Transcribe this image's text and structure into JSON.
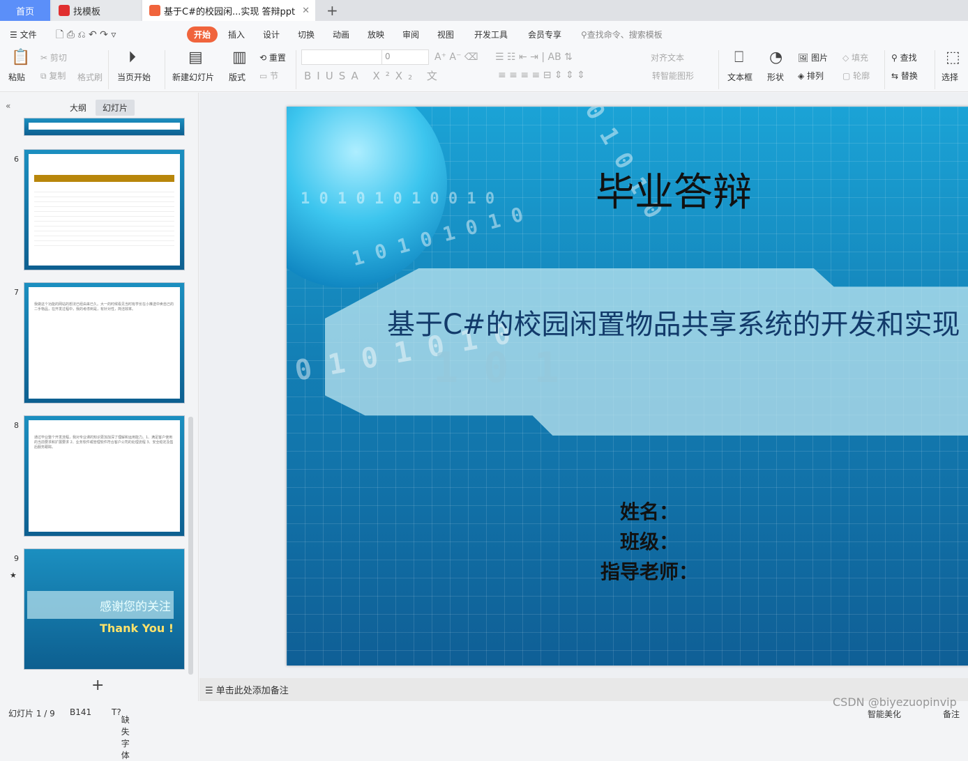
{
  "tabs": {
    "home": "首页",
    "templates": "找模板",
    "document": "基于C#的校园闲...实现 答辩ppt",
    "add": "+"
  },
  "menu": {
    "file": "文件",
    "items": [
      "开始",
      "插入",
      "设计",
      "切换",
      "动画",
      "放映",
      "审阅",
      "视图",
      "开发工具",
      "会员专享"
    ],
    "search_placeholder": "查找命令、搜索模板"
  },
  "ribbon": {
    "paste": "粘贴",
    "cut": "剪切",
    "copy": "复制",
    "format_painter": "格式刷",
    "play_from_current": "当页开始",
    "new_slide": "新建幻灯片",
    "layout": "版式",
    "reset": "重置",
    "section": "节",
    "font_size": "0",
    "align_text": "对齐文本",
    "smart_art": "转智能图形",
    "text_box": "文本框",
    "shapes": "形状",
    "picture": "图片",
    "fill": "填充",
    "arrange": "排列",
    "outline": "轮廓",
    "find": "查找",
    "replace": "替换",
    "select": "选择"
  },
  "sidebar": {
    "tab_outline": "大纲",
    "tab_slides": "幻灯片",
    "slide_numbers": [
      "6",
      "7",
      "8",
      "9"
    ],
    "slide7_text": "我做这个功能的网站的想法已经由来已久。大一的时候看见当时有学长在小推送中卖自己的二手物品，在开发过程中，我的考虑到是，有针对性，简洁效率。",
    "slide8_text": "通过毕业整个开发流程，我对专业课的知识更加加深了理解和运用能力。1、满足客户使用的当前要求和扩展要求 2、业务软件或管理软件符合客户公司的处理流程 3、安全稳定及售后服务跟踪。",
    "slide9_title": "感谢您的关注",
    "slide9_sub": "Thank You !",
    "add": "+"
  },
  "slide": {
    "title": "毕业答辩",
    "subtitle": "基于C#的校园闲置物品共享系统的开发和实现",
    "name": "姓名：",
    "class": "班级：",
    "advisor": "指导老师："
  },
  "notes": "单击此处添加备注",
  "status": {
    "slide": "幻灯片 1 / 9",
    "theme": "B141",
    "missing_font": "缺失字体",
    "beautify": "智能美化",
    "notes_btn": "备注"
  },
  "watermark": "CSDN @biyezuopinvip",
  "colors": {
    "accent": "#f0643c",
    "home_tab": "#5b8ff9"
  }
}
